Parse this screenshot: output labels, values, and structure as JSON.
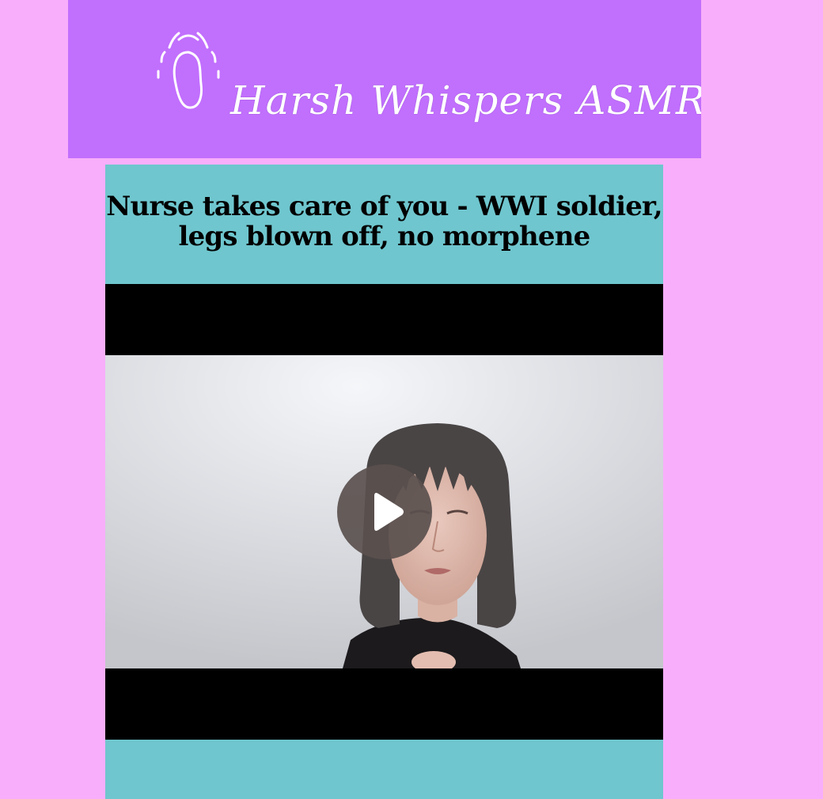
{
  "banner": {
    "title": "Harsh Whispers ASMR",
    "logo_icon": "ear-icon"
  },
  "post": {
    "title": "Nurse takes care of you - WWI soldier, legs blown off, no morphene"
  },
  "video": {
    "play_icon": "play-icon"
  },
  "colors": {
    "page_background": "#f8aefa",
    "banner_background": "#c16ffd",
    "content_background": "#6fc6ce",
    "play_button": "#5a504e"
  }
}
